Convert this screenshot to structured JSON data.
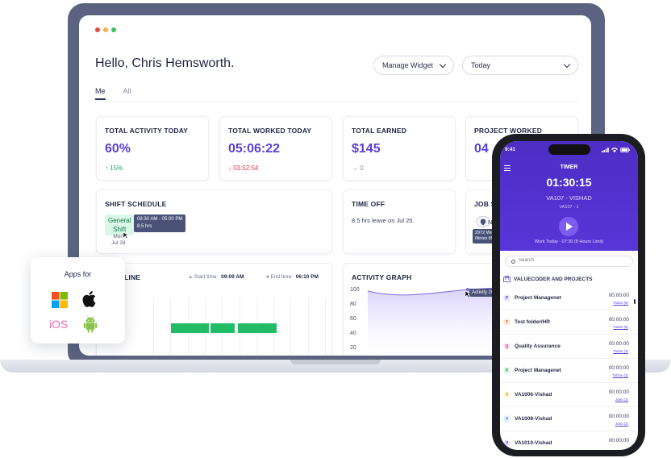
{
  "window": {
    "dot_colors": [
      "#e5483c",
      "#f3b43b",
      "#3fbf5a"
    ]
  },
  "dashboard": {
    "greeting": "Hello, Chris Hemsworth.",
    "manage_widget_label": "Manage Widget",
    "date_range_label": "Today",
    "tabs": [
      {
        "label": "Me",
        "active": true
      },
      {
        "label": "All",
        "active": false
      }
    ],
    "stats": [
      {
        "title": "TOTAL ACTIVITY TODAY",
        "value": "60%",
        "change": "↑ 15%",
        "change_color": "#22a355"
      },
      {
        "title": "TOTAL WORKED TODAY",
        "value": "05:06:22",
        "change": "↓ 03:52:54",
        "change_color": "#e0364a"
      },
      {
        "title": "TOTAL EARNED",
        "value": "$145",
        "change": "→ 0",
        "change_color": "#8a90a6"
      },
      {
        "title": "PROJECT WORKED",
        "value": "04",
        "change": "",
        "change_color": "#8a90a6"
      }
    ],
    "shift_schedule": {
      "title": "SHIFT SCHEDULE",
      "tag_line1": "General",
      "tag_line2": "Shift",
      "tooltip_time": "08:30 AM - 05:00 PM",
      "tooltip_hours": "8.5 hrs",
      "day": "Mon",
      "date": "Jul 28"
    },
    "time_off": {
      "title": "TIME OFF",
      "text": "8.5 hrs leave on Jul 25."
    },
    "job_site": {
      "title": "JOB S",
      "status": "No",
      "tooltip_line1": "2972 West",
      "tooltip_line2": "Illinois 854"
    },
    "timeline": {
      "title": "LINE",
      "start_label": "Start time:",
      "start_value": "09:09 AM",
      "end_label": "End time:",
      "end_value": "06:10 PM"
    },
    "activity_graph": {
      "title": "ACTIVITY GRAPH",
      "y_ticks": [
        "100",
        "80",
        "60",
        "40",
        "20"
      ],
      "tooltip": "Activity 20"
    }
  },
  "apps_for": {
    "title": "Apps for",
    "icons": [
      "windows-icon",
      "apple-icon",
      "ios-icon",
      "android-icon"
    ],
    "ios_text": "iOS"
  },
  "phone": {
    "status_time": "9:41",
    "timer_label": "TIMER",
    "timer_value": "01:30:15",
    "project": "VA107 - VISHAD",
    "project_sub": "VA107 - 1",
    "work_today": "Work Today - 07:30 (8 Hours Limit)",
    "search_placeholder": "Search",
    "org_name": "VALUECODER AND PROJECTS",
    "projects": [
      {
        "badge": "P",
        "name": "Project Managenet",
        "time": "00:00:00",
        "todos": "Todos (6)",
        "bg": "#ece6ff",
        "fg": "#5b3fd6"
      },
      {
        "badge": "T",
        "name": "Test folder/HR",
        "time": "00:00:00",
        "todos": "Todos (6)",
        "bg": "#ffe9df",
        "fg": "#e2642e"
      },
      {
        "badge": "Q",
        "name": "Quality Assurance",
        "time": "00:00:00",
        "todos": "Todos (3)",
        "bg": "#fde4f3",
        "fg": "#c6399a"
      },
      {
        "badge": "P",
        "name": "Project Managenet",
        "time": "00:00:00",
        "todos": "ToDos (2)",
        "bg": "#e1f7e6",
        "fg": "#2a9a4b"
      },
      {
        "badge": "V",
        "name": "VA1006-Vishad",
        "time": "00:00:00",
        "todos": "Jobs (2)",
        "bg": "#fff5d9",
        "fg": "#c99413"
      },
      {
        "badge": "V",
        "name": "VA1008-Vishad",
        "time": "00:00:00",
        "todos": "Jobs (2)",
        "bg": "#e2efff",
        "fg": "#3a78d6"
      },
      {
        "badge": "V",
        "name": "VA1010-Vishad",
        "time": "00:00:00",
        "todos": "",
        "bg": "#ece6ff",
        "fg": "#5b3fd6"
      }
    ]
  },
  "colors": {
    "accent": "#5b3fd6",
    "timeline_bar": "#22bb66",
    "laptop_frame": "#5b6380"
  }
}
